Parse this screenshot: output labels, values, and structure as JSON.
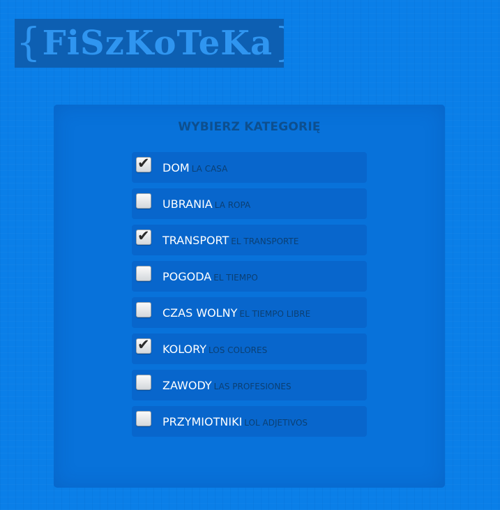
{
  "header": {
    "brace_left": "{",
    "brand": "FiSzKoTeKa",
    "brace_right": "}"
  },
  "panel": {
    "title": "WYBIERZ KATEGORIĘ"
  },
  "checkmark_glyph": "✔",
  "categories": [
    {
      "pl": "DOM",
      "es": "LA CASA",
      "checked": true
    },
    {
      "pl": "UBRANIA",
      "es": "LA ROPA",
      "checked": false
    },
    {
      "pl": "TRANSPORT",
      "es": "EL TRANSPORTE",
      "checked": true
    },
    {
      "pl": "POGODA",
      "es": "EL TIEMPO",
      "checked": false
    },
    {
      "pl": "CZAS WOLNY",
      "es": "EL TIEMPO LIBRE",
      "checked": false
    },
    {
      "pl": "KOLORY",
      "es": "LOS COLORES",
      "checked": true
    },
    {
      "pl": "ZAWODY",
      "es": "LAS PROFESIONES",
      "checked": false
    },
    {
      "pl": "PRZYMIOTNIKI",
      "es": "LOL ADJETIVOS",
      "checked": false
    }
  ],
  "colors": {
    "background": "#0a7fe8",
    "logo_bg": "#0d5fb2",
    "logo_text": "#2f95f0",
    "panel_bg": "#0872da",
    "item_bg": "#0866cc",
    "title_text": "#0d4f8f",
    "label_pl": "#ffffff",
    "label_es": "#0b3f73"
  }
}
